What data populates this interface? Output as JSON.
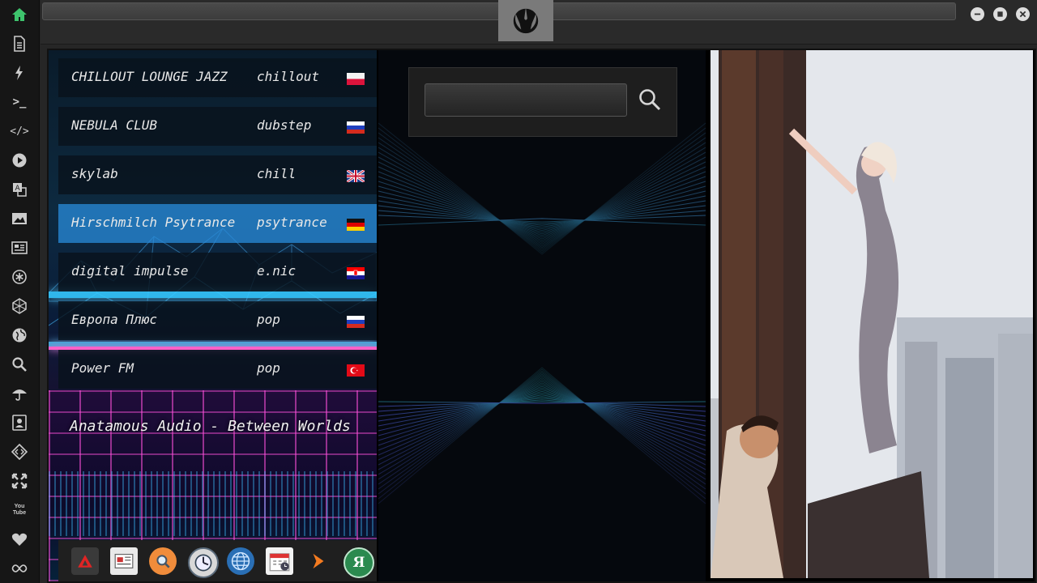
{
  "sidebar": {
    "items": [
      {
        "icon": "home-icon",
        "color": "#3ec46d"
      },
      {
        "icon": "document-icon"
      },
      {
        "icon": "lightning-icon"
      },
      {
        "icon": "terminal-icon",
        "label": ">_"
      },
      {
        "icon": "code-icon",
        "label": "</>"
      },
      {
        "icon": "play-icon"
      },
      {
        "icon": "translate-icon"
      },
      {
        "icon": "image-icon"
      },
      {
        "icon": "news-icon"
      },
      {
        "icon": "asterisk-icon"
      },
      {
        "icon": "hexagon-icon"
      },
      {
        "icon": "globe-icon"
      },
      {
        "icon": "search-icon"
      },
      {
        "icon": "umbrella-icon"
      },
      {
        "icon": "contact-icon"
      },
      {
        "icon": "diamond-code-icon"
      },
      {
        "icon": "expand-icon"
      },
      {
        "icon": "youtube-icon",
        "label": "You Tube"
      },
      {
        "icon": "heart-icon"
      },
      {
        "icon": "infinity-icon"
      }
    ]
  },
  "window": {
    "logo": "rebel-alliance-icon",
    "controls": [
      "minimize-icon",
      "maximize-icon",
      "close-icon"
    ]
  },
  "stations": [
    {
      "name": "CHILLOUT LOUNGE JAZZ",
      "genre": "chillout",
      "flag": "poland"
    },
    {
      "name": "NEBULA CLUB",
      "genre": "dubstep",
      "flag": "russia"
    },
    {
      "name": "skylab",
      "genre": "chill",
      "flag": "united-kingdom"
    },
    {
      "name": "Hirschmilch Psytrance",
      "genre": "psytrance",
      "flag": "germany",
      "active": true
    },
    {
      "name": "digital impulse",
      "genre": "e.nic",
      "flag": "croatia"
    },
    {
      "name": "Европа Плюс",
      "genre": "pop",
      "flag": "russia"
    },
    {
      "name": "Power FM",
      "genre": "pop",
      "flag": "turkey"
    }
  ],
  "now_playing": "Anatamous Audio - Between Worlds",
  "search": {
    "value": ""
  },
  "dock": {
    "apps": [
      "app-launcher-icon",
      "news-reader-icon",
      "search-app-icon",
      "clock-icon",
      "browser-globe-icon",
      "calendar-icon",
      "terminal-arrow-icon",
      "yandex-icon"
    ],
    "yandex_letter": "Я"
  },
  "colors": {
    "accent_green": "#3ec46d",
    "active_station": "#288cdc"
  }
}
